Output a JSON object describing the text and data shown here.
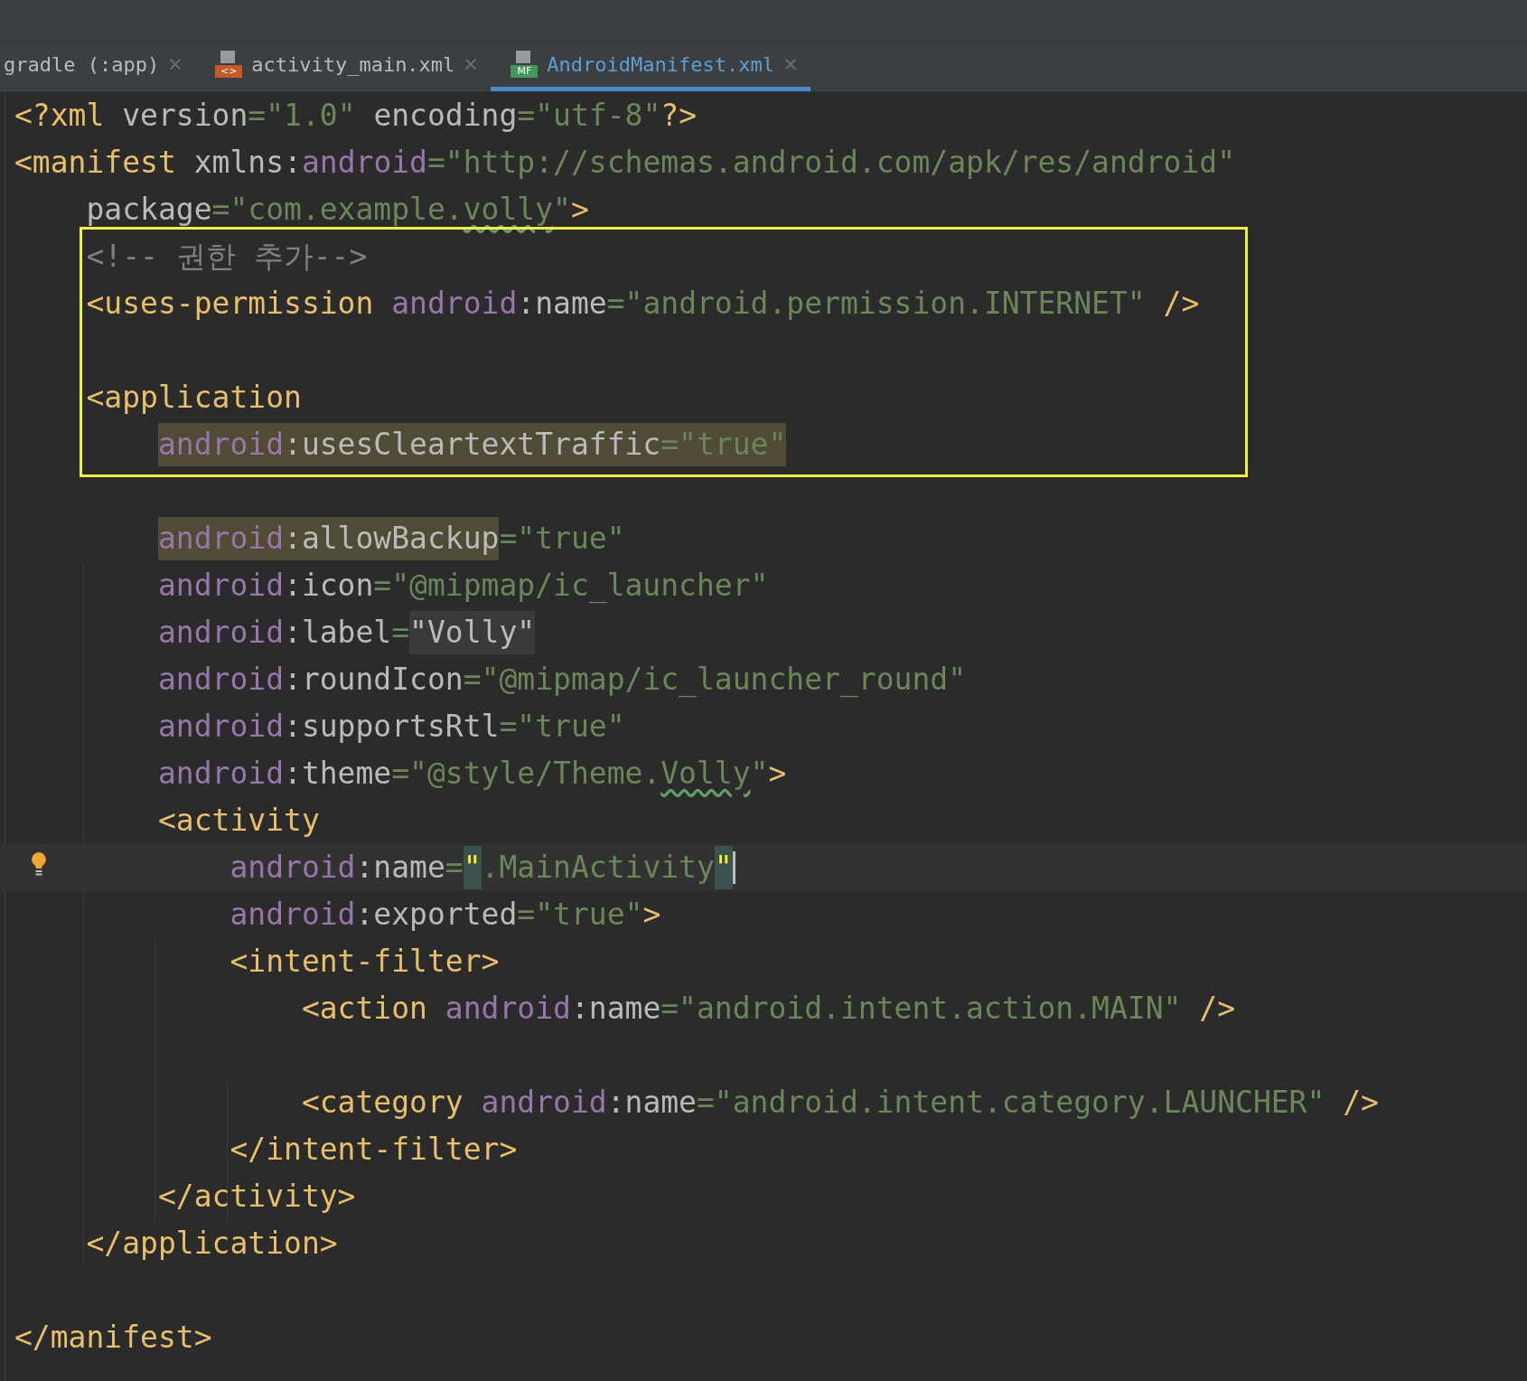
{
  "tabs": [
    {
      "label": "gradle (:app)",
      "selected": false
    },
    {
      "label": "activity_main.xml",
      "icon_label": "<>",
      "kind": "layout",
      "selected": false
    },
    {
      "label": "AndroidManifest.xml",
      "icon_label": "MF",
      "kind": "manifest",
      "selected": true
    }
  ],
  "editor": {
    "lines": [
      {
        "boxed": false,
        "current": false,
        "tokens": [
          {
            "kind": "tag",
            "text": "<?xml "
          },
          {
            "kind": "text",
            "text": "version"
          },
          {
            "kind": "value",
            "text": "=\"1.0\" "
          },
          {
            "kind": "text",
            "text": "encoding"
          },
          {
            "kind": "value",
            "text": "=\"utf-8\""
          },
          {
            "kind": "tag",
            "text": "?>"
          }
        ]
      },
      {
        "boxed": false,
        "current": false,
        "tokens": [
          {
            "kind": "tag",
            "text": "<manifest "
          },
          {
            "kind": "text",
            "text": "xmlns:"
          },
          {
            "kind": "ns",
            "text": "android"
          },
          {
            "kind": "value",
            "text": "=\"http://schemas.android.com/apk/res/android\""
          }
        ],
        "children": [
          {
            "boxed": false,
            "current": false,
            "tokens": [
              {
                "kind": "text",
                "text": "package"
              },
              {
                "kind": "value",
                "text": "=\"com.example."
              },
              {
                "kind": "value",
                "text": "volly",
                "typo": true
              },
              {
                "kind": "value",
                "text": "\""
              },
              {
                "kind": "tag",
                "text": ">"
              }
            ]
          },
          {
            "boxed": true,
            "current": false,
            "tokens": [
              {
                "kind": "comment",
                "text": "<!-- 권한 추가-->"
              }
            ]
          },
          {
            "boxed": true,
            "current": false,
            "tokens": [
              {
                "kind": "tag",
                "text": "<uses-permission "
              },
              {
                "kind": "ns",
                "text": "android"
              },
              {
                "kind": "text",
                "text": ":name"
              },
              {
                "kind": "value",
                "text": "=\"android.permission.INTERNET\" "
              },
              {
                "kind": "tag",
                "text": "/>"
              }
            ]
          },
          {
            "boxed": true,
            "current": false
          },
          {
            "boxed": true,
            "current": false,
            "tokens": [
              {
                "kind": "tag",
                "text": "<application"
              }
            ],
            "children": [
              {
                "boxed": true,
                "current": false,
                "tokens": [
                  {
                    "kind": "usage_highlight",
                    "tokens": [
                      {
                        "kind": "ns",
                        "text": "android"
                      },
                      {
                        "kind": "text",
                        "text": ":usesCleartextTraffic"
                      },
                      {
                        "kind": "value",
                        "text": "=\"true\""
                      }
                    ]
                  }
                ]
              },
              {
                "boxed": false,
                "current": false
              },
              {
                "boxed": false,
                "current": false,
                "tokens": [
                  {
                    "kind": "usage_highlight",
                    "tokens": [
                      {
                        "kind": "ns",
                        "text": "android"
                      },
                      {
                        "kind": "text",
                        "text": ":allowBackup"
                      }
                    ]
                  },
                  {
                    "kind": "value",
                    "text": "=\"true\""
                  }
                ]
              },
              {
                "boxed": false,
                "current": false,
                "tokens": [
                  {
                    "kind": "ns",
                    "text": "android"
                  },
                  {
                    "kind": "text",
                    "text": ":icon"
                  },
                  {
                    "kind": "value",
                    "text": "=\"@mipmap/ic_launcher\""
                  }
                ]
              },
              {
                "boxed": false,
                "current": false,
                "tokens": [
                  {
                    "kind": "ns",
                    "text": "android"
                  },
                  {
                    "kind": "text",
                    "text": ":label"
                  },
                  {
                    "kind": "value",
                    "text": "="
                  },
                  {
                    "kind": "folded",
                    "tokens": [
                      {
                        "kind": "text",
                        "text": "\"Volly\""
                      }
                    ]
                  }
                ]
              },
              {
                "boxed": false,
                "current": false,
                "tokens": [
                  {
                    "kind": "ns",
                    "text": "android"
                  },
                  {
                    "kind": "text",
                    "text": ":roundIcon"
                  },
                  {
                    "kind": "value",
                    "text": "=\"@mipmap/ic_launcher_round\""
                  }
                ]
              },
              {
                "boxed": false,
                "current": false,
                "tokens": [
                  {
                    "kind": "ns",
                    "text": "android"
                  },
                  {
                    "kind": "text",
                    "text": ":supportsRtl"
                  },
                  {
                    "kind": "value",
                    "text": "=\"true\""
                  }
                ]
              },
              {
                "boxed": false,
                "current": false,
                "tokens": [
                  {
                    "kind": "ns",
                    "text": "android"
                  },
                  {
                    "kind": "text",
                    "text": ":theme"
                  },
                  {
                    "kind": "value",
                    "text": "=\"@style/Theme."
                  },
                  {
                    "kind": "value",
                    "text": "Volly",
                    "typo": true
                  },
                  {
                    "kind": "value",
                    "text": "\""
                  },
                  {
                    "kind": "tag",
                    "text": ">"
                  }
                ]
              },
              {
                "boxed": false,
                "current": false,
                "tokens": [
                  {
                    "kind": "tag",
                    "text": "<activity"
                  }
                ],
                "children": [
                  {
                    "boxed": false,
                    "current": true,
                    "tokens": [
                      {
                        "kind": "ns",
                        "text": "android"
                      },
                      {
                        "kind": "text",
                        "text": ":name"
                      },
                      {
                        "kind": "value",
                        "text": "="
                      },
                      {
                        "kind": "brace_match",
                        "tokens": [
                          {
                            "kind": "quote",
                            "text": "\""
                          }
                        ]
                      },
                      {
                        "kind": "value",
                        "text": ".MainActivity"
                      },
                      {
                        "kind": "brace_match",
                        "tokens": [
                          {
                            "kind": "quote",
                            "text": "\""
                          }
                        ]
                      }
                    ]
                  },
                  {
                    "boxed": false,
                    "current": false,
                    "tokens": [
                      {
                        "kind": "ns",
                        "text": "android"
                      },
                      {
                        "kind": "text",
                        "text": ":exported"
                      },
                      {
                        "kind": "value",
                        "text": "=\"true\""
                      },
                      {
                        "kind": "tag",
                        "text": ">"
                      }
                    ]
                  },
                  {
                    "boxed": false,
                    "current": false,
                    "tokens": [
                      {
                        "kind": "tag",
                        "text": "<intent-filter>"
                      }
                    ],
                    "children": [
                      {
                        "boxed": false,
                        "current": false,
                        "tokens": [
                          {
                            "kind": "tag",
                            "text": "<action "
                          },
                          {
                            "kind": "ns",
                            "text": "android"
                          },
                          {
                            "kind": "text",
                            "text": ":name"
                          },
                          {
                            "kind": "value",
                            "text": "=\"android.intent.action.MAIN\" "
                          },
                          {
                            "kind": "tag",
                            "text": "/>"
                          }
                        ]
                      },
                      {
                        "boxed": false,
                        "current": false
                      },
                      {
                        "boxed": false,
                        "current": false,
                        "tokens": [
                          {
                            "kind": "tag",
                            "text": "<category "
                          },
                          {
                            "kind": "ns",
                            "text": "android"
                          },
                          {
                            "kind": "text",
                            "text": ":name"
                          },
                          {
                            "kind": "value",
                            "text": "=\"android.intent.category.LAUNCHER\" "
                          },
                          {
                            "kind": "tag",
                            "text": "/>"
                          }
                        ]
                      }
                    ]
                  },
                  {
                    "boxed": false,
                    "current": false,
                    "tokens": [
                      {
                        "kind": "tag",
                        "text": "</intent-filter>"
                      }
                    ]
                  }
                ]
              },
              {
                "boxed": false,
                "current": false,
                "tokens": [
                  {
                    "kind": "tag",
                    "text": "</activity>"
                  }
                ]
              }
            ]
          },
          {
            "boxed": false,
            "current": false,
            "tokens": [
              {
                "kind": "tag",
                "text": "</application>"
              }
            ]
          }
        ]
      },
      {
        "boxed": false,
        "current": false
      },
      {
        "boxed": false,
        "current": false,
        "tokens": [
          {
            "kind": "tag",
            "text": "</manifest>"
          }
        ]
      }
    ]
  }
}
